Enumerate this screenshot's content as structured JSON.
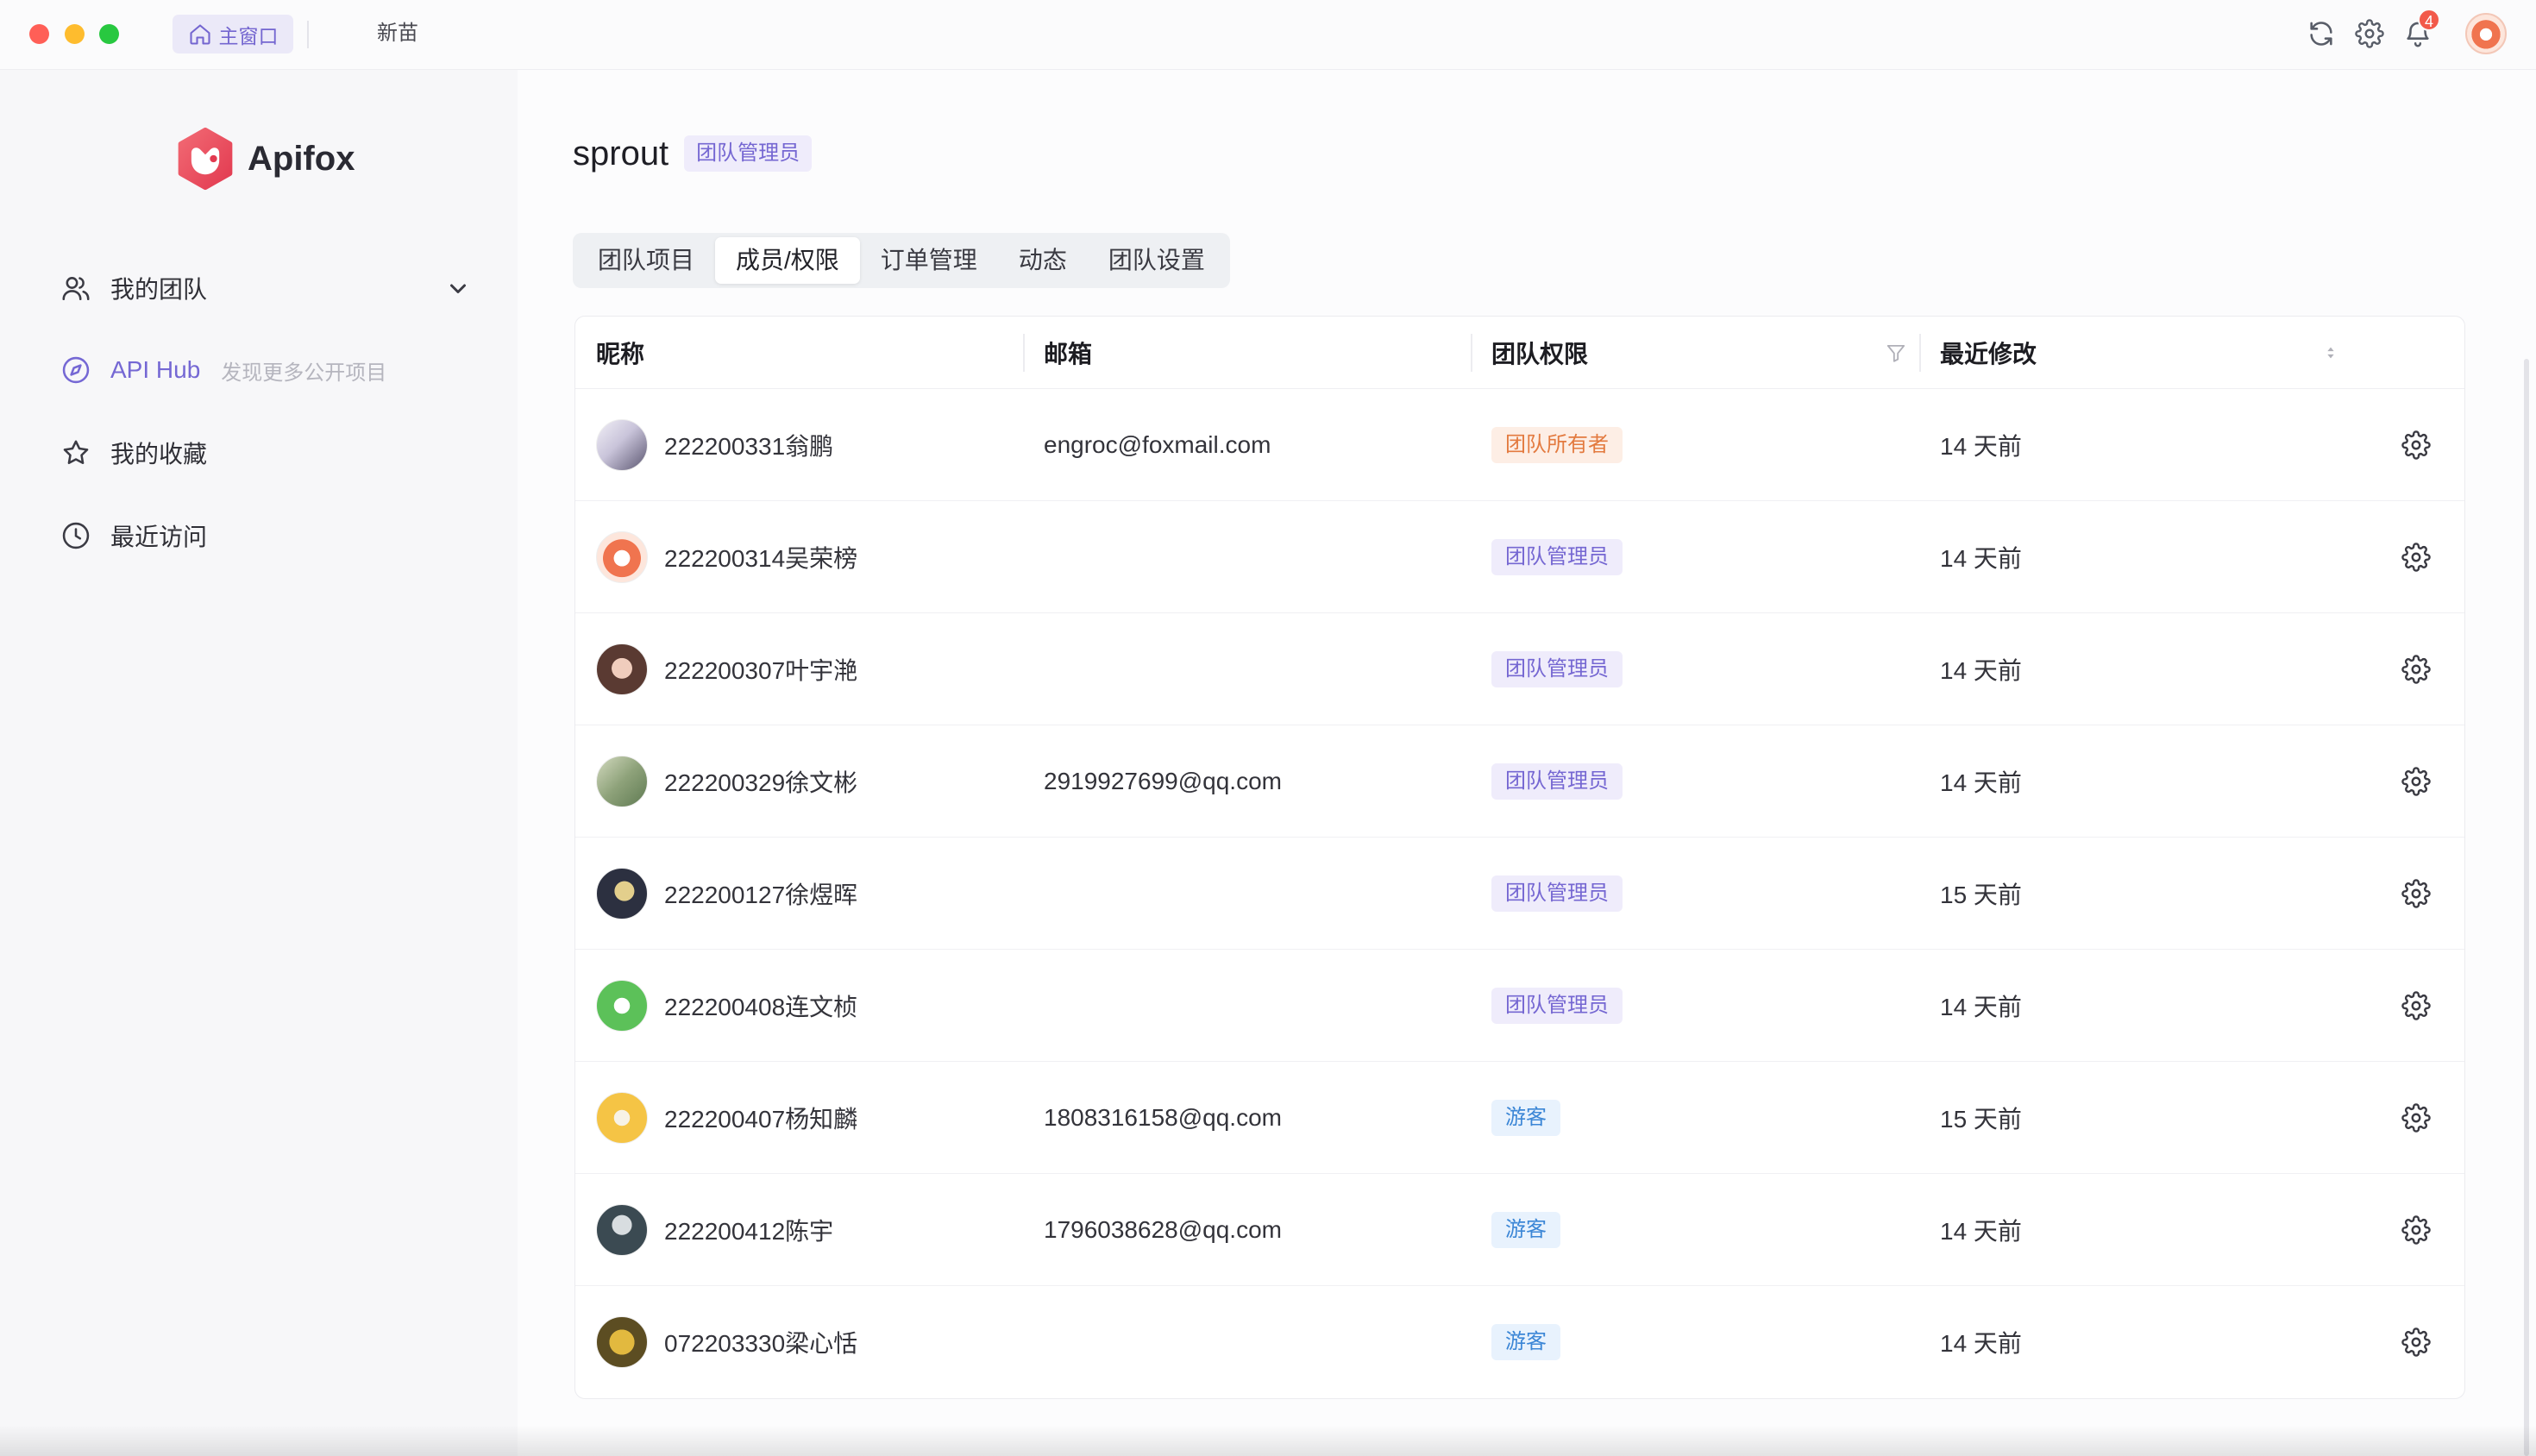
{
  "window": {
    "tabs": [
      {
        "label": "主窗口",
        "icon": "home-icon",
        "active": true
      },
      {
        "label": "新苗",
        "active": false
      }
    ],
    "actions": {
      "refresh_icon": "refresh-icon",
      "settings_icon": "gear-icon",
      "notifications_icon": "bell-icon",
      "notification_count": "4"
    }
  },
  "sidebar": {
    "brand": "Apifox",
    "items": [
      {
        "label": "我的团队",
        "icon": "team-icon",
        "expandable": true
      },
      {
        "label": "API Hub",
        "hint": "发现更多公开项目",
        "icon": "compass-icon"
      },
      {
        "label": "我的收藏",
        "icon": "star-icon"
      },
      {
        "label": "最近访问",
        "icon": "clock-icon"
      }
    ]
  },
  "team": {
    "name": "sprout",
    "role": "团队管理员"
  },
  "tabs": [
    {
      "label": "团队项目",
      "active": false
    },
    {
      "label": "成员/权限",
      "active": true
    },
    {
      "label": "订单管理",
      "active": false
    },
    {
      "label": "动态",
      "active": false
    },
    {
      "label": "团队设置",
      "active": false
    }
  ],
  "table": {
    "columns": {
      "nickname": "昵称",
      "email": "邮箱",
      "role": "团队权限",
      "modified": "最近修改"
    },
    "role_colors": {
      "团队所有者": {
        "bg": "#fdeee5",
        "fg": "#e37a3f"
      },
      "团队管理员": {
        "bg": "#efecfb",
        "fg": "#7567d2"
      },
      "游客": {
        "bg": "#e8f2fd",
        "fg": "#3b86d6"
      }
    },
    "rows": [
      {
        "nickname": "222200331翁鹏",
        "email": "engroc@foxmail.com",
        "role": "团队所有者",
        "modified": "14 天前"
      },
      {
        "nickname": "222200314吴荣榜",
        "email": "",
        "role": "团队管理员",
        "modified": "14 天前"
      },
      {
        "nickname": "222200307叶宇滟",
        "email": "",
        "role": "团队管理员",
        "modified": "14 天前"
      },
      {
        "nickname": "222200329徐文彬",
        "email": "2919927699@qq.com",
        "role": "团队管理员",
        "modified": "14 天前"
      },
      {
        "nickname": "222200127徐煜晖",
        "email": "",
        "role": "团队管理员",
        "modified": "15 天前"
      },
      {
        "nickname": "222200408连文桢",
        "email": "",
        "role": "团队管理员",
        "modified": "14 天前"
      },
      {
        "nickname": "222200407杨知麟",
        "email": "1808316158@qq.com",
        "role": "游客",
        "modified": "15 天前"
      },
      {
        "nickname": "222200412陈宇",
        "email": "1796038628@qq.com",
        "role": "游客",
        "modified": "14 天前"
      },
      {
        "nickname": "072203330梁心恬",
        "email": "",
        "role": "游客",
        "modified": "14 天前"
      }
    ]
  },
  "colors": {
    "accent": "#7568d4",
    "sidebar_bg": "#f7f7f9",
    "notification": "#f2594a"
  }
}
